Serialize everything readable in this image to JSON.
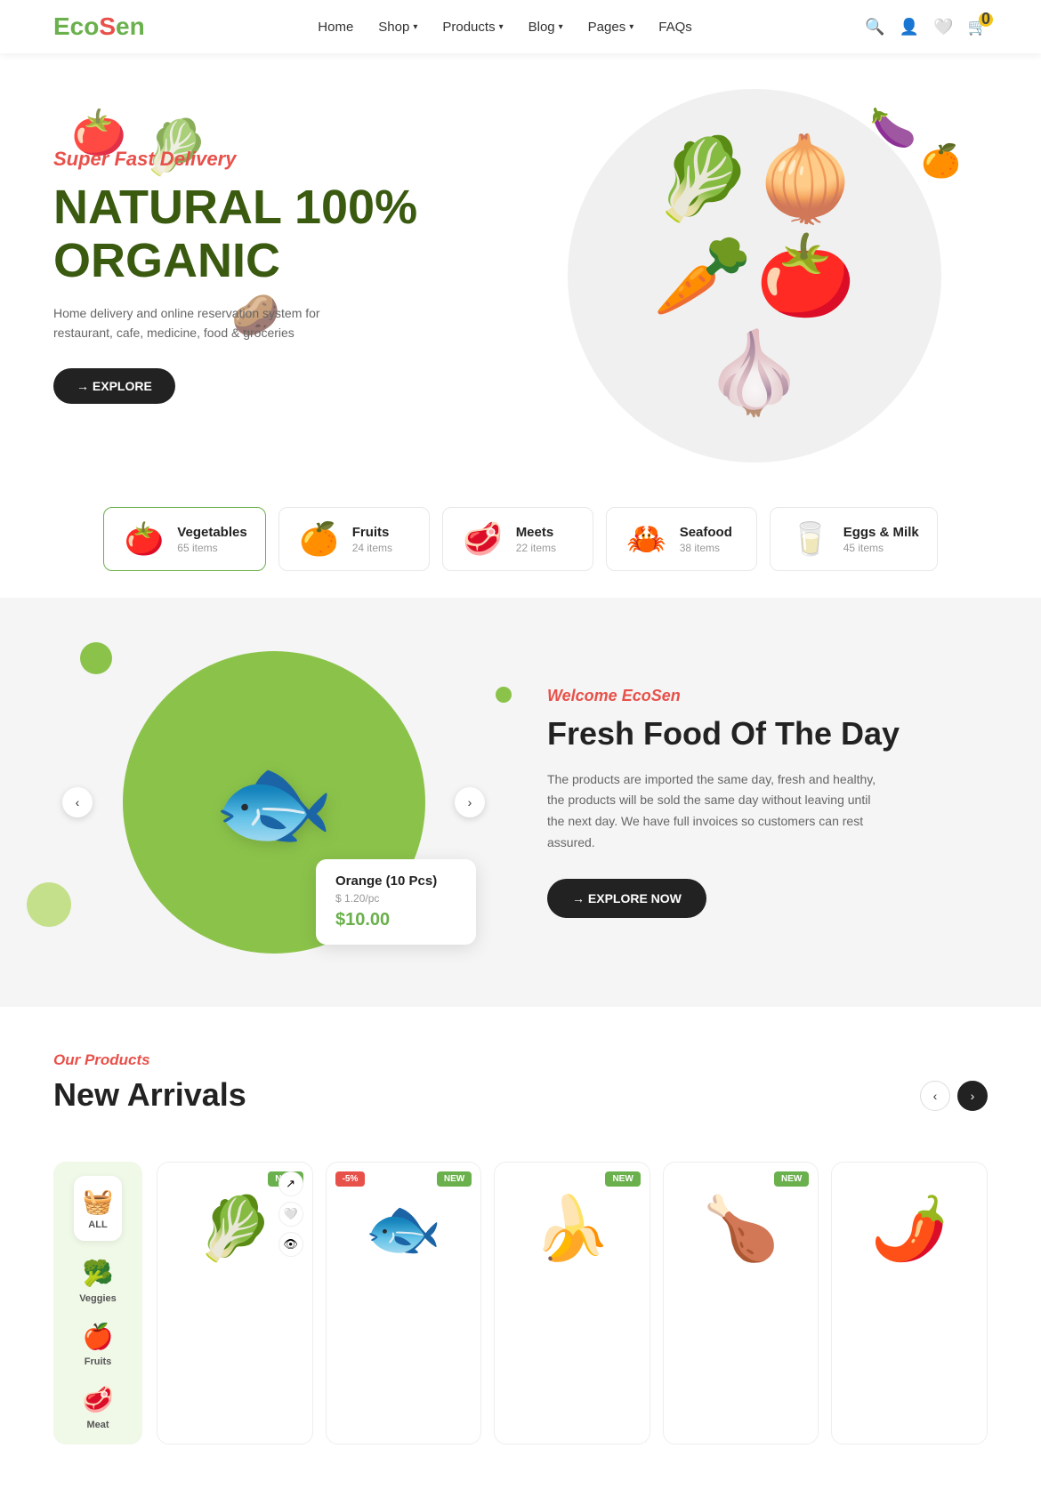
{
  "brand": {
    "logo_eco": "Eco",
    "logo_sen": "Sen",
    "logo_icon": "🌿"
  },
  "nav": {
    "links": [
      {
        "label": "Home",
        "has_dropdown": false
      },
      {
        "label": "Shop",
        "has_dropdown": true
      },
      {
        "label": "Products",
        "has_dropdown": true
      },
      {
        "label": "Blog",
        "has_dropdown": true
      },
      {
        "label": "Pages",
        "has_dropdown": true
      },
      {
        "label": "FAQs",
        "has_dropdown": false
      }
    ]
  },
  "hero": {
    "tag": "Super Fast Delivery",
    "title_line1": "NATURAL 100%",
    "title_line2": "ORGANIC",
    "description": "Home delivery and online reservation system for restaurant, cafe, medicine, food & groceries",
    "btn_label": "→ EXPLORE"
  },
  "categories": [
    {
      "name": "Vegetables",
      "count": "65 items",
      "icon": "🍅",
      "active": true
    },
    {
      "name": "Fruits",
      "count": "24 items",
      "icon": "🍊",
      "active": false
    },
    {
      "name": "Meets",
      "count": "22 items",
      "icon": "🥩",
      "active": false
    },
    {
      "name": "Seafood",
      "count": "38 items",
      "icon": "🦀",
      "active": false
    },
    {
      "name": "Eggs & Milk",
      "count": "45 items",
      "icon": "🥛",
      "active": false
    }
  ],
  "fresh_section": {
    "tag": "Welcome EcoSen",
    "title": "Fresh Food Of The Day",
    "description": "The products are imported the same day, fresh and healthy, the products will be sold the same day without leaving until the next day. We have full invoices so customers can rest assured.",
    "btn_label": "→ EXPLORE NOW",
    "product_name": "Orange (10 Pcs)",
    "product_unit": "$ 1.20/pc",
    "product_price": "$10.00"
  },
  "new_arrivals": {
    "section_tag": "Our Products",
    "section_title": "New Arrivals",
    "products": [
      {
        "name": "Bok Choy",
        "icon": "🥬",
        "badge": "NEW",
        "badge_type": "new"
      },
      {
        "name": "Salmon",
        "icon": "🐟",
        "badge": "-5%",
        "badge_type": "sale",
        "badge2": "NEW"
      },
      {
        "name": "Bananas",
        "icon": "🍌",
        "badge": "NEW",
        "badge_type": "new"
      },
      {
        "name": "Chicken",
        "icon": "🍗",
        "badge": "NEW",
        "badge_type": "new"
      },
      {
        "name": "Chili",
        "icon": "🌶️",
        "badge": "",
        "badge_type": "none"
      }
    ],
    "filter_items": [
      {
        "label": "ALL",
        "icon": "🧺",
        "active": true
      },
      {
        "label": "Veggies",
        "icon": "🥦"
      },
      {
        "label": "Fruits",
        "icon": "🍎"
      },
      {
        "label": "Meat",
        "icon": "🥩"
      }
    ]
  }
}
